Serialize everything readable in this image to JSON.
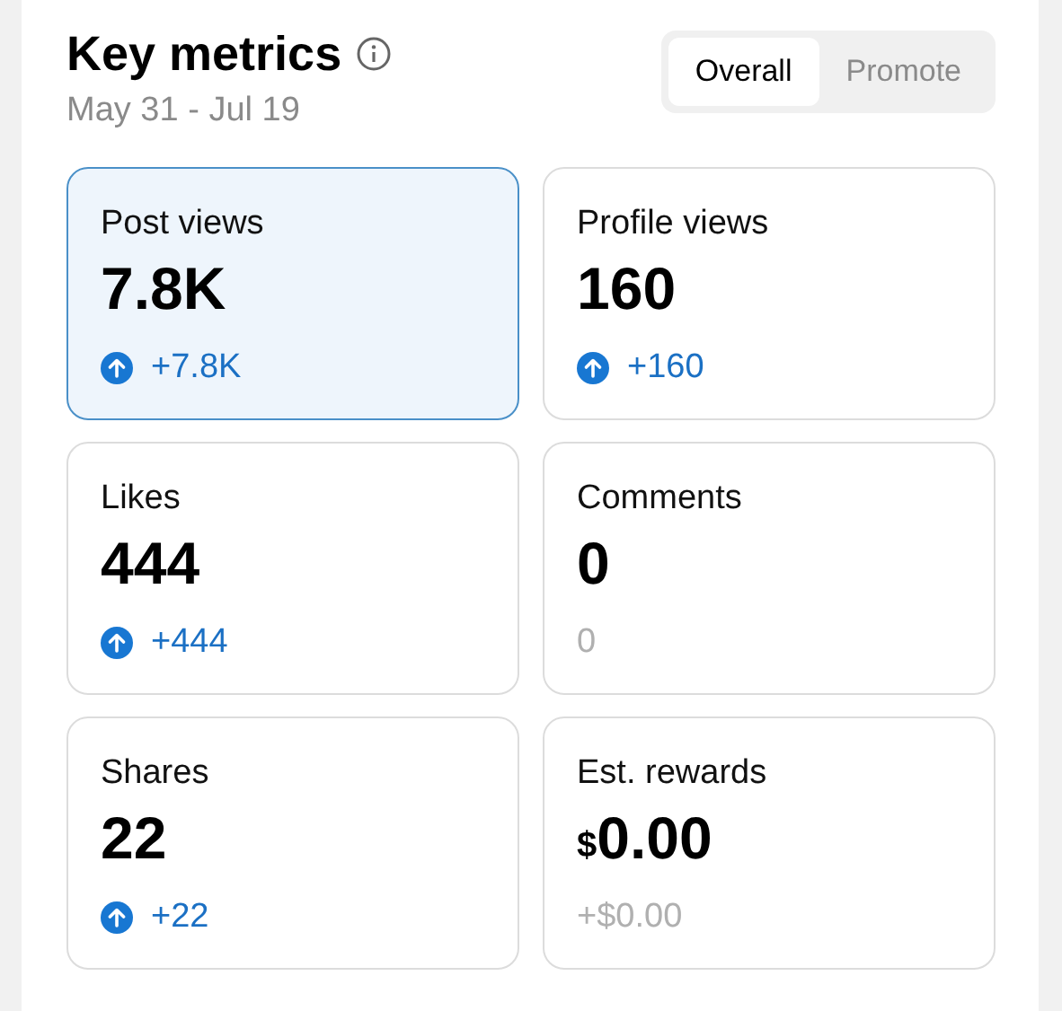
{
  "header": {
    "title": "Key metrics",
    "date_range": "May 31 - Jul 19"
  },
  "tabs": [
    {
      "label": "Overall",
      "selected": true
    },
    {
      "label": "Promote",
      "selected": false
    }
  ],
  "metrics": [
    {
      "label": "Post views",
      "value": "7.8K",
      "change": "+7.8K",
      "kind": "up",
      "selected": true
    },
    {
      "label": "Profile views",
      "value": "160",
      "change": "+160",
      "kind": "up",
      "selected": false
    },
    {
      "label": "Likes",
      "value": "444",
      "change": "+444",
      "kind": "up",
      "selected": false
    },
    {
      "label": "Comments",
      "value": "0",
      "change": "0",
      "kind": "flat",
      "selected": false
    },
    {
      "label": "Shares",
      "value": "22",
      "change": "+22",
      "kind": "up",
      "selected": false
    },
    {
      "label": "Est. rewards",
      "currency": "$",
      "value": "0.00",
      "change": "+$0.00",
      "kind": "flat",
      "selected": false
    }
  ]
}
